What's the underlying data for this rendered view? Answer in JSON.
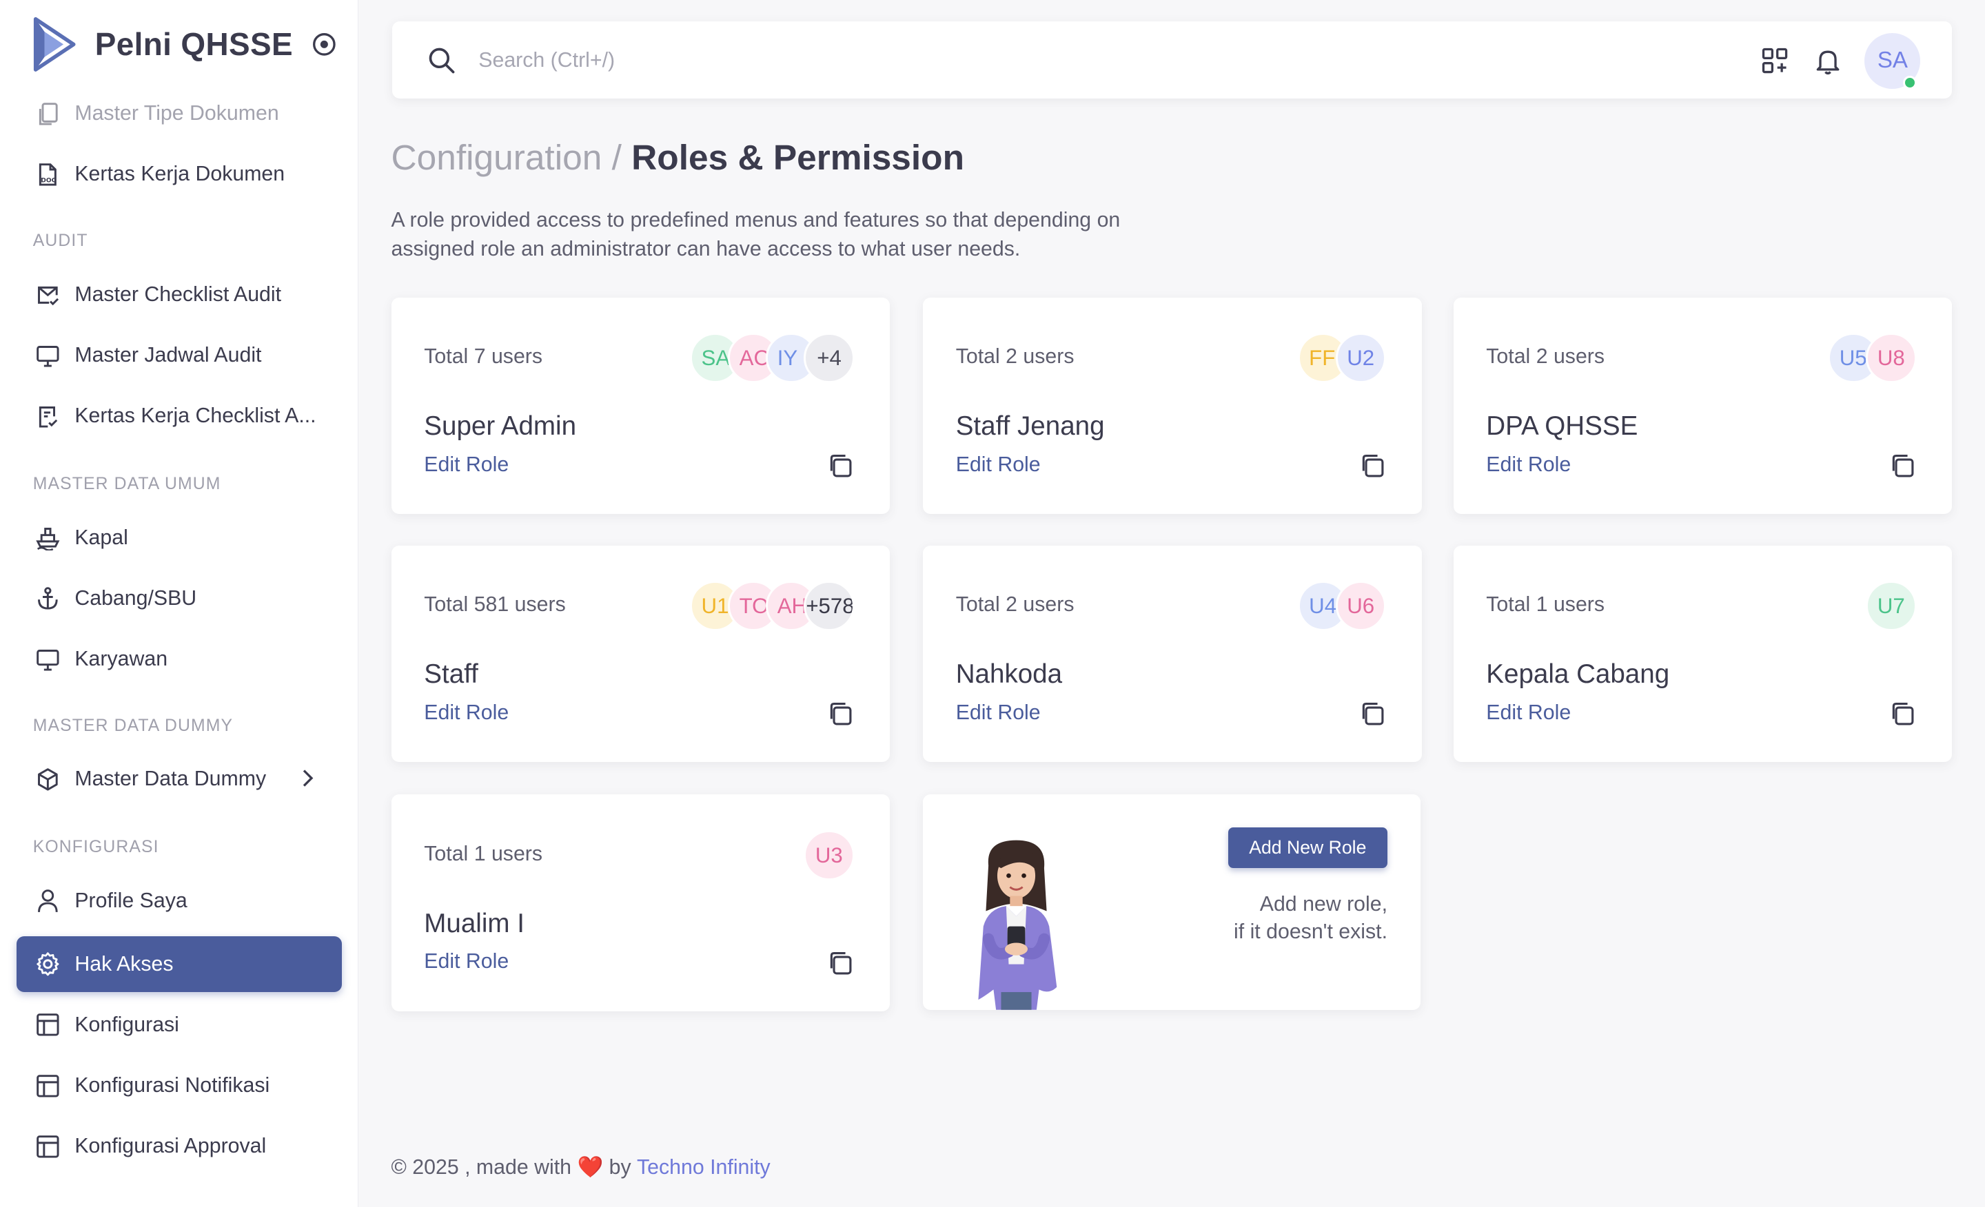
{
  "app": {
    "name": "Pelni QHSSE"
  },
  "sidebar": {
    "items_top": [
      {
        "label": "Master Tipe Dokumen",
        "icon": "copy-doc-icon"
      },
      {
        "label": "Kertas Kerja Dokumen",
        "icon": "doc-file-icon"
      }
    ],
    "sections": [
      {
        "title": "AUDIT"
      },
      {
        "title": "MASTER DATA UMUM"
      },
      {
        "title": "MASTER DATA DUMMY"
      },
      {
        "title": "KONFIGURASI"
      }
    ],
    "audit_items": [
      {
        "label": "Master Checklist Audit",
        "icon": "mail-check-icon"
      },
      {
        "label": "Master Jadwal Audit",
        "icon": "monitor-icon"
      },
      {
        "label": "Kertas Kerja Checklist A...",
        "icon": "clipboard-check-icon"
      }
    ],
    "umum_items": [
      {
        "label": "Kapal",
        "icon": "ship-icon"
      },
      {
        "label": "Cabang/SBU",
        "icon": "anchor-icon"
      },
      {
        "label": "Karyawan",
        "icon": "monitor-icon"
      }
    ],
    "dummy_items": [
      {
        "label": "Master Data Dummy",
        "icon": "box-icon"
      }
    ],
    "konfig_items": [
      {
        "label": "Profile Saya",
        "icon": "user-icon"
      },
      {
        "label": "Hak Akses",
        "icon": "gear-icon",
        "active": true
      },
      {
        "label": "Konfigurasi",
        "icon": "table-icon"
      },
      {
        "label": "Konfigurasi Notifikasi",
        "icon": "table-icon"
      },
      {
        "label": "Konfigurasi Approval",
        "icon": "table-icon"
      }
    ]
  },
  "topbar": {
    "search_placeholder": "Search (Ctrl+/)",
    "avatar_initials": "SA"
  },
  "page": {
    "breadcrumb": "Configuration /",
    "title": "Roles & Permission",
    "description_line1": "A role provided access to predefined menus and features so that depending on",
    "description_line2": "assigned role an administrator can have access to what user needs."
  },
  "roles": [
    {
      "total": "Total 7 users",
      "name": "Super Admin",
      "edit": "Edit Role",
      "avatars": [
        {
          "t": "SA",
          "bg": "#e4f6ec",
          "fg": "#4cc38a"
        },
        {
          "t": "AC",
          "bg": "#fde7ef",
          "fg": "#e3679a"
        },
        {
          "t": "IY",
          "bg": "#e7ecfb",
          "fg": "#6f8fe6"
        },
        {
          "t": "+4",
          "bg": "#ececf0",
          "fg": "#4a4a58",
          "more": true
        }
      ]
    },
    {
      "total": "Total 2 users",
      "name": "Staff Jenang",
      "edit": "Edit Role",
      "avatars": [
        {
          "t": "FF",
          "bg": "#fdf3d7",
          "fg": "#f0b429"
        },
        {
          "t": "U2",
          "bg": "#e7ebfb",
          "fg": "#6f83e6"
        }
      ]
    },
    {
      "total": "Total 2 users",
      "name": "DPA QHSSE",
      "edit": "Edit Role",
      "avatars": [
        {
          "t": "U5",
          "bg": "#e7ecfb",
          "fg": "#6f8fe6"
        },
        {
          "t": "U8",
          "bg": "#fde7ef",
          "fg": "#e3679a"
        }
      ]
    },
    {
      "total": "Total 581 users",
      "name": "Staff",
      "edit": "Edit Role",
      "avatars": [
        {
          "t": "U1",
          "bg": "#fdf3d7",
          "fg": "#f0b429"
        },
        {
          "t": "TO",
          "bg": "#fde7ef",
          "fg": "#e3679a"
        },
        {
          "t": "AH",
          "bg": "#fde7ef",
          "fg": "#e3679a"
        },
        {
          "t": "+578",
          "bg": "#ececf0",
          "fg": "#3a3a48",
          "more": true
        }
      ]
    },
    {
      "total": "Total 2 users",
      "name": "Nahkoda",
      "edit": "Edit Role",
      "avatars": [
        {
          "t": "U4",
          "bg": "#e7ecfb",
          "fg": "#6f8fe6"
        },
        {
          "t": "U6",
          "bg": "#fde7ef",
          "fg": "#e3679a"
        }
      ]
    },
    {
      "total": "Total 1 users",
      "name": "Kepala Cabang",
      "edit": "Edit Role",
      "avatars": [
        {
          "t": "U7",
          "bg": "#e4f6ec",
          "fg": "#4cc38a"
        }
      ]
    },
    {
      "total": "Total 1 users",
      "name": "Mualim I",
      "edit": "Edit Role",
      "avatars": [
        {
          "t": "U3",
          "bg": "#fde7ef",
          "fg": "#e3679a"
        }
      ]
    }
  ],
  "add_role": {
    "button": "Add New Role",
    "note_line1": "Add new role,",
    "note_line2": "if it doesn't exist."
  },
  "footer": {
    "prefix": "© 2025 , made with",
    "heart": "❤️",
    "by": "by",
    "company": "Techno Infinity"
  },
  "colors": {
    "primary": "#4a5c9c",
    "online": "#38c172"
  }
}
